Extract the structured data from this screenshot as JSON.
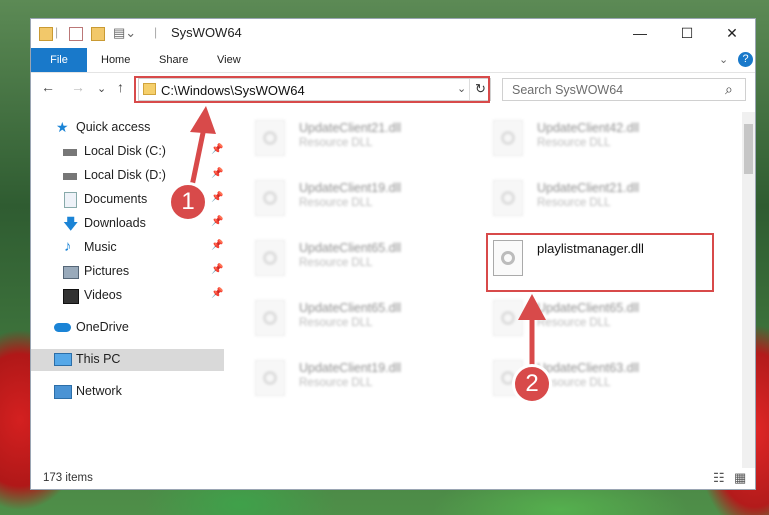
{
  "window": {
    "title": "SysWOW64",
    "qa_separator": "|",
    "minimize": "—",
    "maximize": "☐",
    "close": "✕"
  },
  "ribbon": {
    "tabs": [
      "File",
      "Home",
      "Share",
      "View"
    ],
    "expand": "⌄",
    "help": "?"
  },
  "nav": {
    "back": "←",
    "forward": "→",
    "recent": "⌄",
    "up": "↑",
    "address": "C:\\Windows\\SysWOW64",
    "address_dropdown": "⌄",
    "refresh": "↻",
    "search_placeholder": "Search SysWOW64",
    "search_icon": "⌕"
  },
  "sidebar": {
    "items": [
      {
        "label": "Quick access",
        "icon": "star-icon",
        "color": "#1b84d6"
      },
      {
        "label": "Local Disk (C:)",
        "icon": "drive-icon",
        "pinned": true
      },
      {
        "label": "Local Disk (D:)",
        "icon": "drive-icon",
        "pinned": true
      },
      {
        "label": "Documents",
        "icon": "documents-icon",
        "pinned": true
      },
      {
        "label": "Downloads",
        "icon": "download-arrow-icon",
        "pinned": true
      },
      {
        "label": "Music",
        "icon": "music-note-icon",
        "pinned": true
      },
      {
        "label": "Pictures",
        "icon": "pictures-icon",
        "pinned": true
      },
      {
        "label": "Videos",
        "icon": "videos-icon",
        "pinned": true
      },
      {
        "label": "OneDrive",
        "icon": "cloud-icon"
      },
      {
        "label": "This PC",
        "icon": "computer-icon",
        "selected": true
      },
      {
        "label": "Network",
        "icon": "network-icon"
      }
    ],
    "pin_glyph": "📌"
  },
  "files": [
    {
      "name": "UpdateClient21.dll",
      "type": "Resource DLL"
    },
    {
      "name": "UpdateClient42.dll",
      "type": "Resource DLL"
    },
    {
      "name": "UpdateClient19.dll",
      "type": "Resource DLL"
    },
    {
      "name": "UpdateClient21.dll",
      "type": "Resource DLL"
    },
    {
      "name": "UpdateClient65.dll",
      "type": "Resource DLL"
    },
    {
      "name": "playlistmanager.dll",
      "type": ""
    },
    {
      "name": "UpdateClient65.dll",
      "type": "Resource DLL"
    },
    {
      "name": "UpdateClient65.dll",
      "type": "Resource DLL"
    },
    {
      "name": "UpdateClient19.dll",
      "type": "Resource DLL"
    },
    {
      "name": "UpdateClient63.dll",
      "type": "Resource DLL"
    }
  ],
  "status": {
    "count": "173 items",
    "details_view_icon": "☷",
    "tiles_view_icon": "▦"
  },
  "annotations": {
    "step1": "1",
    "step2": "2",
    "color": "#d84a4a"
  }
}
